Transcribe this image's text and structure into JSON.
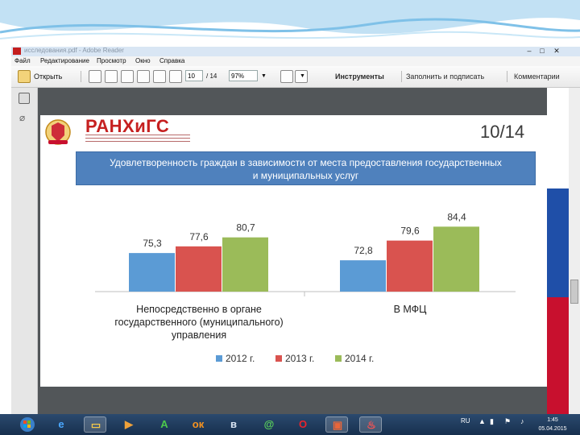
{
  "window": {
    "title": "исследования.pdf - Adobe Reader",
    "minimize": "–",
    "maximize": "□",
    "close": "✕"
  },
  "menu": [
    "Файл",
    "Редактирование",
    "Просмотр",
    "Окно",
    "Справка"
  ],
  "toolbar": {
    "open_label": "Открыть",
    "page_current": "10",
    "page_total": "/ 14",
    "zoom": "97%",
    "tools_label": "Инструменты",
    "fill_sign_label": "Заполнить и подписать",
    "comments_label": "Комментарии"
  },
  "slide": {
    "logo_text": "РАНХиГС",
    "page_label": "10/14",
    "banner_line1": "Удовлетворенность граждан в зависимости от места предоставления государственных",
    "banner_line2": "и муниципальных услуг"
  },
  "chart_data": {
    "type": "bar",
    "categories": [
      "Непосредственно в органе государственного (муниципального) управления",
      "В МФЦ"
    ],
    "category_lines": [
      [
        "Непосредственно в органе",
        "государственного (муниципального)",
        "управления"
      ],
      [
        "В МФЦ"
      ]
    ],
    "series": [
      {
        "name": "2012 г.",
        "values": [
          75.3,
          72.8
        ],
        "labels": [
          "75,3",
          "72,8"
        ],
        "color": "#5b9bd5"
      },
      {
        "name": "2013 г.",
        "values": [
          77.6,
          79.6
        ],
        "labels": [
          "77,6",
          "79,6"
        ],
        "color": "#d9534f"
      },
      {
        "name": "2014 г.",
        "values": [
          80.7,
          84.4
        ],
        "labels": [
          "80,7",
          "84,4"
        ],
        "color": "#9bbb59"
      }
    ],
    "legend_position": "bottom",
    "grid": false
  },
  "taskbar": {
    "start_icon": "windows-start-icon",
    "apps": [
      "internet-explorer-icon",
      "file-explorer-icon",
      "media-player-icon",
      "green-a-icon",
      "odnoklassniki-icon",
      "vk-icon",
      "mail-at-icon",
      "opera-icon",
      "presentation-icon",
      "adobe-reader-icon"
    ],
    "lang": "RU",
    "time": "1:45",
    "date": "05.04.2015"
  }
}
